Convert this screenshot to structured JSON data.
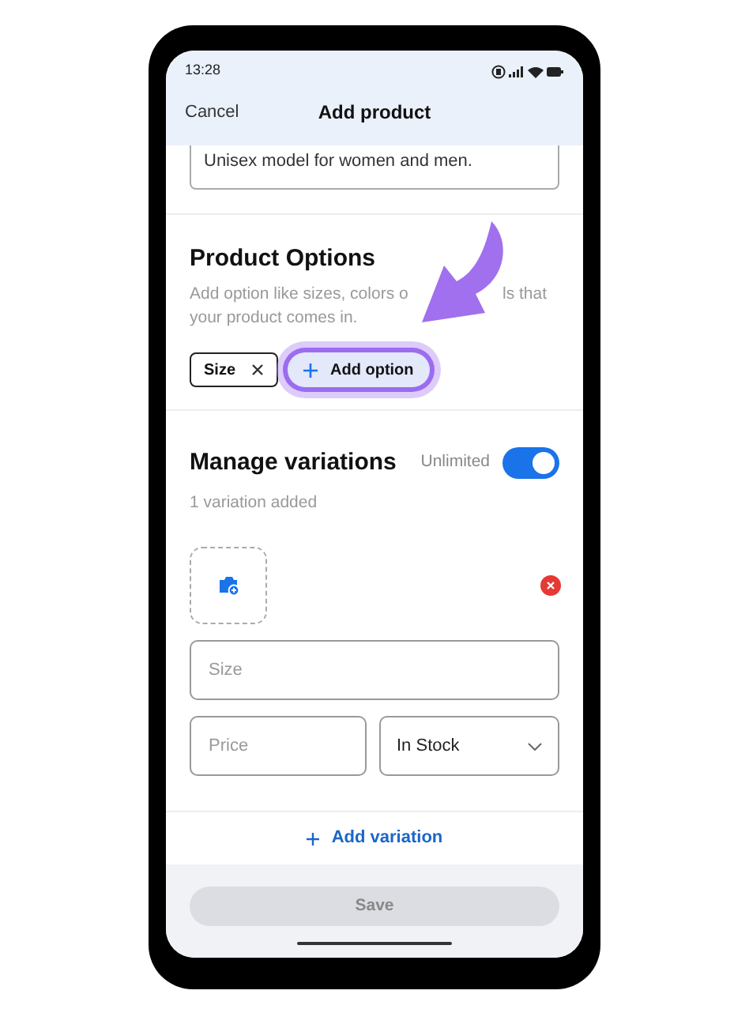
{
  "status_bar": {
    "time": "13:28"
  },
  "header": {
    "cancel": "Cancel",
    "title": "Add product"
  },
  "description_field": {
    "value": "Unisex model for women and men."
  },
  "product_options": {
    "title": "Product Options",
    "hint_parts": [
      "Add option like sizes, colors o",
      "ls that",
      "your product comes in."
    ],
    "chips": [
      {
        "label": "Size"
      }
    ],
    "add_option": {
      "label": "Add option",
      "highlighted": true
    }
  },
  "variations": {
    "title": "Manage variations",
    "toggle_label": "Unlimited",
    "toggle_on": true,
    "count": "1 variation added",
    "size_field": {
      "placeholder": "Size"
    },
    "price_field": {
      "placeholder": "Price"
    },
    "stock_select": {
      "value": "In Stock"
    },
    "add_variation": "Add variation"
  },
  "save_button": {
    "label": "Save",
    "disabled": true
  }
}
